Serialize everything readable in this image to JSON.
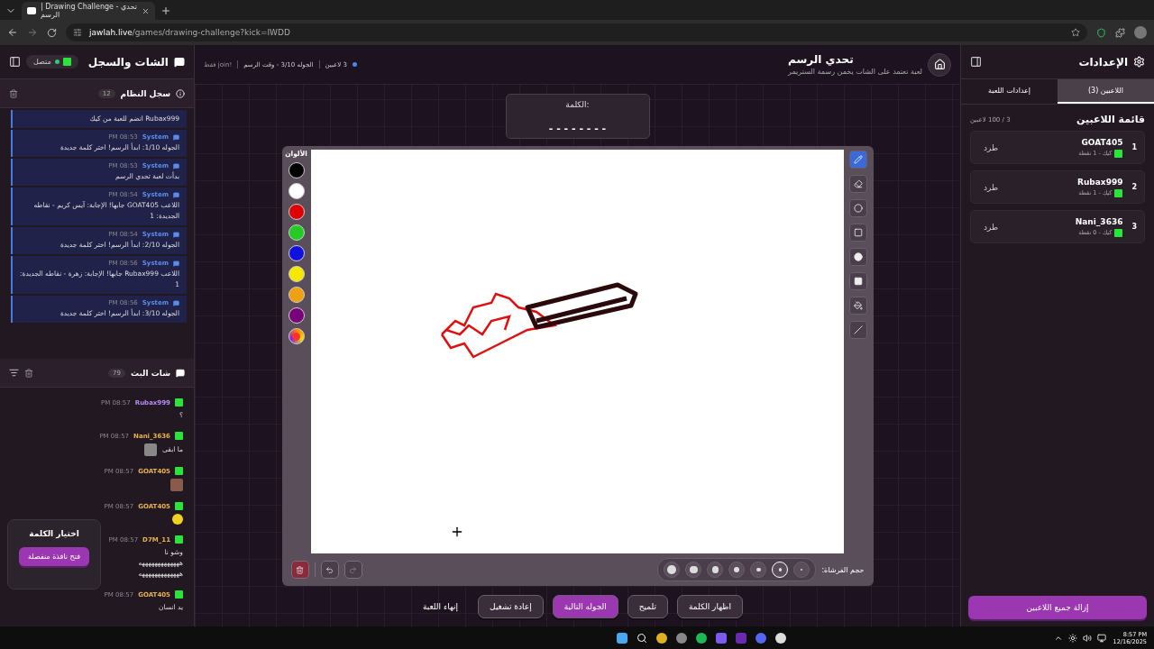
{
  "browser": {
    "tab_title": "| Drawing Challenge - تحدي الرسم",
    "url_host": "jawlah.live",
    "url_path": "/games/drawing-challenge?kick=IWDD"
  },
  "left_panel": {
    "title": "الشات والسجل",
    "status": "متصل",
    "log": {
      "title": "سجل النظام",
      "count": "12",
      "entries": [
        {
          "text": "Rubax999 انضم للعبة من كيك"
        },
        {
          "sender": "System",
          "time": "PM 08:53",
          "text": "الجوله 1/10: ابدأ الرسم! اختر كلمة جديدة"
        },
        {
          "sender": "System",
          "time": "PM 08:53",
          "text": "بدأت لعبة تحدي الرسم"
        },
        {
          "sender": "System",
          "time": "PM 08:54",
          "text": "اللاعب GOAT405 جابها! الإجابة: آيس كريم - نقاطه الجديدة: 1"
        },
        {
          "sender": "System",
          "time": "PM 08:54",
          "text": "الجوله 2/10: ابدأ الرسم! اختر كلمة جديدة"
        },
        {
          "sender": "System",
          "time": "PM 08:56",
          "text": "اللاعب Rubax999 جابها! الإجابة: زهرة - نقاطه الجديدة: 1"
        },
        {
          "sender": "System",
          "time": "PM 08:56",
          "text": "الجوله 3/10: ابدأ الرسم! اختر كلمة جديدة"
        }
      ]
    },
    "chat": {
      "title": "شات البث",
      "count": "79",
      "messages": [
        {
          "user": "Rubax999",
          "color": "#b58cf2",
          "time": "PM 08:57",
          "text": "؟",
          "kind": "text"
        },
        {
          "user": "Nani_3636",
          "color": "#e9b24c",
          "time": "PM 08:57",
          "text": "ما ابقى",
          "kind": "text-image"
        },
        {
          "user": "GOAT405",
          "color": "#e9b24c",
          "time": "PM 08:57",
          "kind": "image"
        },
        {
          "user": "GOAT405",
          "color": "#e9b24c",
          "time": "PM 08:57",
          "kind": "emoji"
        },
        {
          "user": "D7M_11",
          "color": "#e9b24c",
          "time": "PM 08:57",
          "text": "وشو نا\nهههههههههههههه\nهههههههههههههه",
          "kind": "text"
        },
        {
          "user": "GOAT405",
          "color": "#e9b24c",
          "time": "PM 08:57",
          "text": "يد انسان",
          "kind": "text"
        }
      ]
    },
    "word_popup": {
      "title": "اختيار الكلمة",
      "button": "فتح نافذة منفصلة"
    }
  },
  "header": {
    "title": "تحدي الرسم",
    "subtitle": "لعبة تعتمد على الشات يخمن رسمة الستريمر",
    "players": "3 لاعبين",
    "round": "الجوله 3/10 - وقت الرسم",
    "join": "!join فقط"
  },
  "word": {
    "label": "الكلمة:",
    "hint": "- - - - - - - -"
  },
  "canvas": {
    "colors_label": "الألوان",
    "colors": [
      {
        "color": "#000000",
        "kind": "swatch"
      },
      {
        "color": "#ffffff",
        "kind": "swatch"
      },
      {
        "color": "#e00000",
        "kind": "swatch"
      },
      {
        "color": "#22cc22",
        "kind": "swatch"
      },
      {
        "color": "#1010e0",
        "kind": "swatch"
      },
      {
        "color": "#f5e900",
        "kind": "swatch"
      },
      {
        "color": "#f0a010",
        "kind": "swatch"
      },
      {
        "color": "#7a007a",
        "kind": "swatch"
      },
      {
        "color": "#ff3030",
        "kind": "picker"
      }
    ],
    "tools": [
      {
        "kind": "pen",
        "selected": true
      },
      {
        "kind": "eraser",
        "selected": false
      },
      {
        "kind": "circle",
        "selected": false
      },
      {
        "kind": "rect",
        "selected": false
      },
      {
        "kind": "filled-circle",
        "selected": false
      },
      {
        "kind": "filled-rect",
        "selected": false
      },
      {
        "kind": "fill",
        "selected": false
      },
      {
        "kind": "line",
        "selected": false
      }
    ],
    "brush_label": "حجم الفرشاة:",
    "brush_sizes": [
      {
        "selected": false
      },
      {
        "selected": true
      },
      {
        "selected": false
      },
      {
        "selected": false
      },
      {
        "selected": false
      },
      {
        "selected": false
      },
      {
        "selected": false
      }
    ]
  },
  "actions": [
    {
      "label": "اظهار الكلمة",
      "kind": "default"
    },
    {
      "label": "تلميح",
      "kind": "default"
    },
    {
      "label": "الجوله التالية",
      "kind": "primary"
    },
    {
      "label": "إعادة تشغيل",
      "kind": "default"
    },
    {
      "label": "إنهاء اللعبة",
      "kind": "text"
    }
  ],
  "right_panel": {
    "title": "الإعدادات",
    "tabs": [
      {
        "label": "اللاعبين (3)",
        "selected": true
      },
      {
        "label": "إعدادات اللعبة",
        "selected": false
      }
    ],
    "list_title": "قائمة اللاعبين",
    "capacity": "3 / 100 لاعبين",
    "players": [
      {
        "rank": "1",
        "name": "GOAT405",
        "details": "كيك - 1 نقطة",
        "action": "طرد"
      },
      {
        "rank": "2",
        "name": "Rubax999",
        "details": "كيك - 1 نقطة",
        "action": "طرد"
      },
      {
        "rank": "3",
        "name": "Nani_3636",
        "details": "كيك - 0 نقطة",
        "action": "طرد"
      }
    ],
    "remove_all": "إزالة جميع اللاعبين"
  },
  "taskbar": {
    "time": "8:57 PM",
    "date": "12/16/2025"
  }
}
